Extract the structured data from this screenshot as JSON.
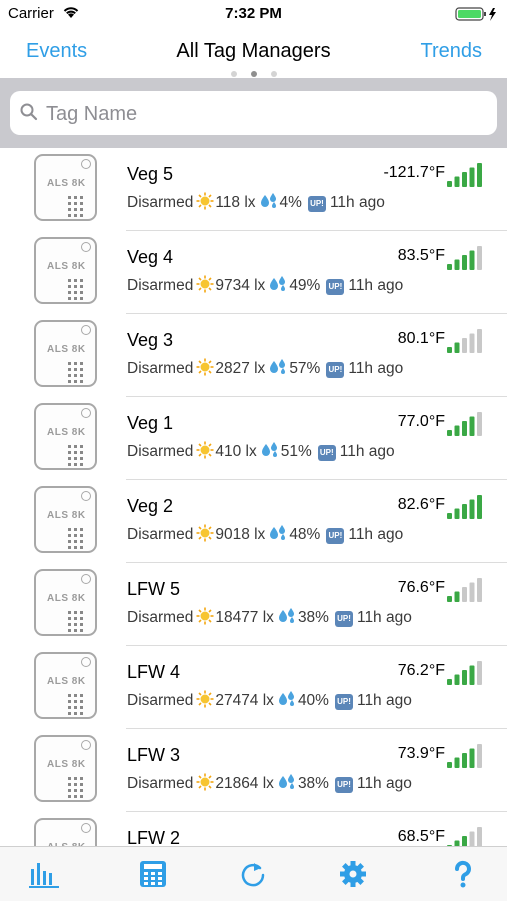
{
  "status_bar": {
    "carrier": "Carrier",
    "time": "7:32 PM"
  },
  "nav": {
    "left": "Events",
    "title": "All Tag Managers",
    "right": "Trends"
  },
  "search": {
    "placeholder": "Tag Name"
  },
  "device_label": "ALS 8K",
  "tags": [
    {
      "name": "Veg 5",
      "temp": "-121.7°F",
      "status": "Disarmed",
      "lux": "118 lx",
      "humidity": "4%",
      "ago": "11h ago",
      "signal": 5
    },
    {
      "name": "Veg 4",
      "temp": "83.5°F",
      "status": "Disarmed",
      "lux": "9734 lx",
      "humidity": "49%",
      "ago": "11h ago",
      "signal": 4
    },
    {
      "name": "Veg 3",
      "temp": "80.1°F",
      "status": "Disarmed",
      "lux": "2827 lx",
      "humidity": "57%",
      "ago": "11h ago",
      "signal": 2
    },
    {
      "name": "Veg 1",
      "temp": "77.0°F",
      "status": "Disarmed",
      "lux": "410 lx",
      "humidity": "51%",
      "ago": "11h ago",
      "signal": 4
    },
    {
      "name": "Veg 2",
      "temp": "82.6°F",
      "status": "Disarmed",
      "lux": "9018 lx",
      "humidity": "48%",
      "ago": "11h ago",
      "signal": 5
    },
    {
      "name": "LFW 5",
      "temp": "76.6°F",
      "status": "Disarmed",
      "lux": "18477 lx",
      "humidity": "38%",
      "ago": "11h ago",
      "signal": 2
    },
    {
      "name": "LFW 4",
      "temp": "76.2°F",
      "status": "Disarmed",
      "lux": "27474 lx",
      "humidity": "40%",
      "ago": "11h ago",
      "signal": 4
    },
    {
      "name": "LFW 3",
      "temp": "73.9°F",
      "status": "Disarmed",
      "lux": "21864 lx",
      "humidity": "38%",
      "ago": "11h ago",
      "signal": 4
    },
    {
      "name": "LFW 2",
      "temp": "68.5°F",
      "status": "",
      "lux": "",
      "humidity": "",
      "ago": "",
      "signal": 3
    }
  ],
  "tabbar": [
    {
      "icon": "bar-chart-icon"
    },
    {
      "icon": "calculator-icon"
    },
    {
      "icon": "refresh-icon"
    },
    {
      "icon": "gear-icon"
    },
    {
      "icon": "help-icon"
    }
  ],
  "colors": {
    "accent": "#2f9ee6",
    "signal_on": "#3aa845",
    "signal_off": "#c8c8c8",
    "search_bg": "#c9c9ce"
  }
}
